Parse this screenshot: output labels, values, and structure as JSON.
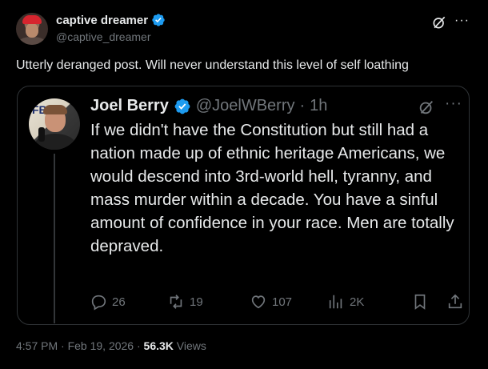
{
  "author": {
    "display_name": "captive dreamer",
    "handle": "@captive_dreamer"
  },
  "post": {
    "text": "Utterly deranged post.  Will never understand this level of self loathing"
  },
  "quoted": {
    "display_name": "Joel Berry",
    "handle": "@JoelWBerry",
    "separator": "·",
    "time": "1h",
    "text": "If we didn't have the Constitution but still had a nation made up of ethnic heritage Americans, we would descend into 3rd-world hell, tyranny, and mass murder within a decade. You have a sinful amount of confidence in your race. Men are totally depraved.",
    "replies": "26",
    "reposts": "19",
    "likes": "107",
    "views": "2K"
  },
  "meta": {
    "timestamp": "4:57 PM · Feb 19, 2026 · ",
    "views_count": "56.3K",
    "views_label": " Views"
  },
  "colors": {
    "background": "#000000",
    "text": "#e7e9ea",
    "muted": "#71767b",
    "verified": "#1d9bf0",
    "border": "#2f3336"
  },
  "icons": [
    "verified-badge-icon",
    "grok-icon",
    "more-icon",
    "reply-icon",
    "repost-icon",
    "like-icon",
    "views-icon",
    "bookmark-icon",
    "share-icon"
  ]
}
